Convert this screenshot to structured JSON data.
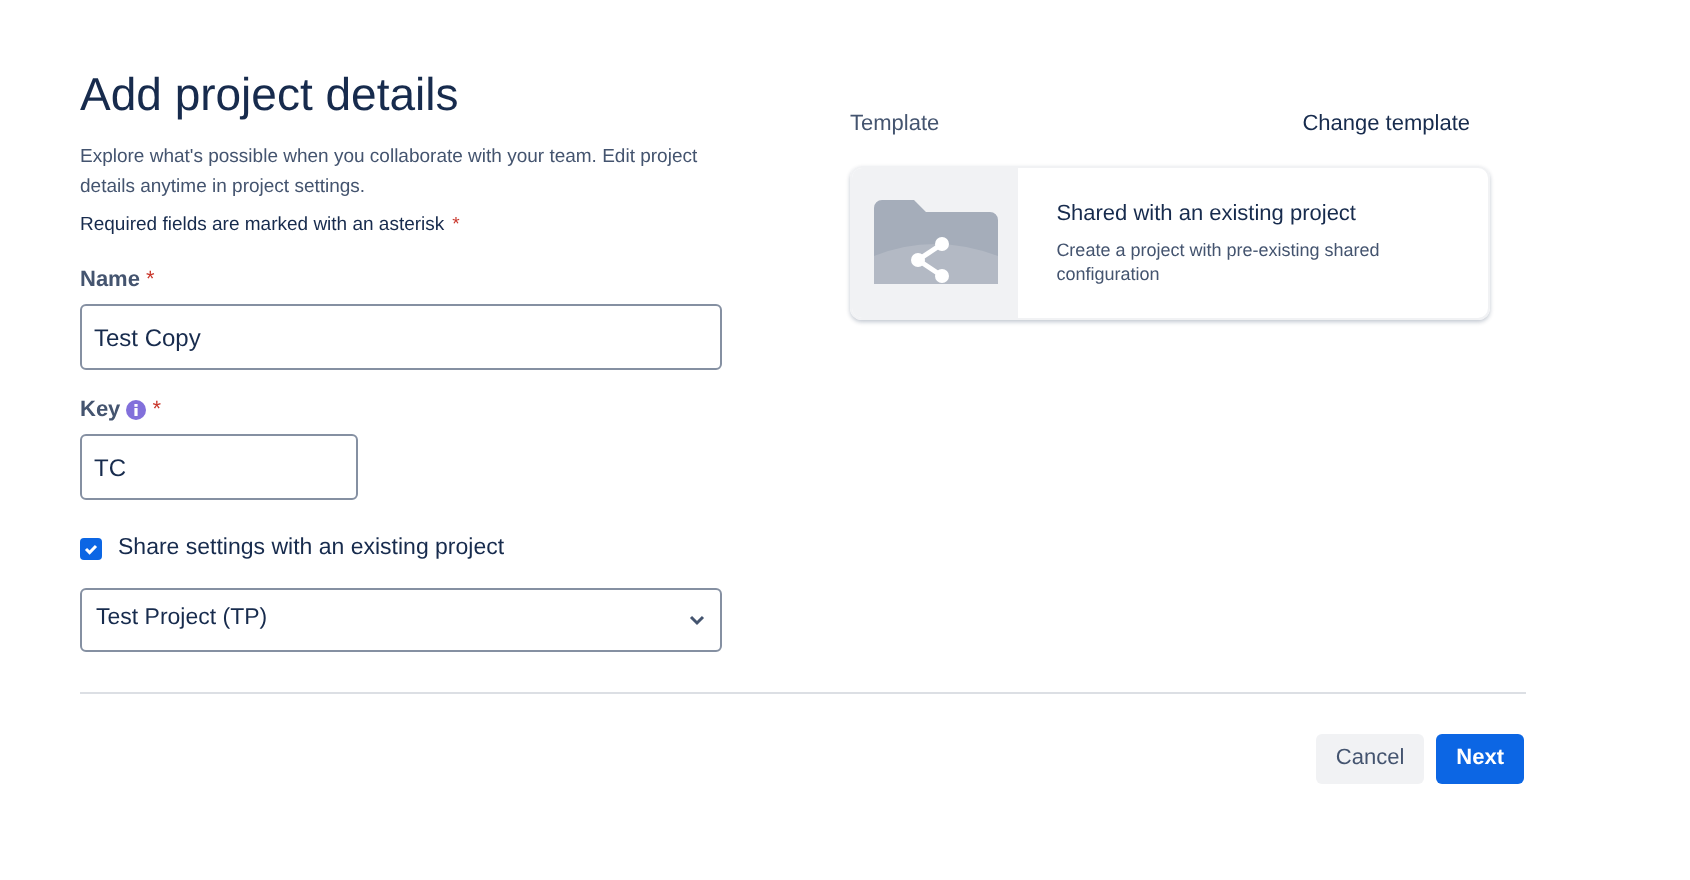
{
  "title": "Add project details",
  "intro": "Explore what's possible when you collaborate with your team. Edit project details anytime in project settings.",
  "required_note": {
    "text": "Required fields are marked with an asterisk",
    "asterisk": "*"
  },
  "fields": [
    {
      "label": "Name",
      "asterisk": "*",
      "value": "Test Copy",
      "info": false
    },
    {
      "label": "Key",
      "asterisk": "*",
      "value": "TC",
      "info": true
    }
  ],
  "share_checkbox": {
    "label": "Share settings with an existing project",
    "checked": true
  },
  "project_select": {
    "value": "Test Project (TP)"
  },
  "template": {
    "label": "Template",
    "change_link": "Change template",
    "card": {
      "title": "Shared with an existing project",
      "description": "Create a project with pre-existing shared configuration"
    }
  },
  "buttons": [
    {
      "label": "Cancel",
      "kind": "subtle"
    },
    {
      "label": "Next",
      "kind": "primary"
    }
  ]
}
